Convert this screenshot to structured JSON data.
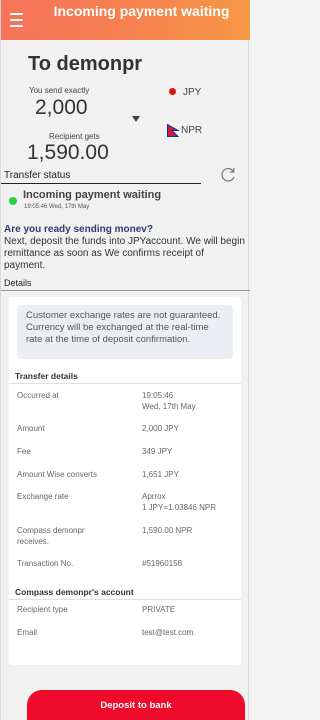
{
  "header": {
    "title": "Incoming payment waiting",
    "accent_color": "#f7804f"
  },
  "summary": {
    "recipient_name": "To demonpr",
    "send_label": "You send exactly",
    "send_amount": "2,000",
    "send_currency": "JPY",
    "receive_label": "Recipient gets",
    "receive_amount": "1,590.00",
    "receive_currency": "NPR"
  },
  "status": {
    "heading": "Transfer status",
    "text": "Incoming payment waiting",
    "time": "19:05:46 Wed, 17th May",
    "dot_color": "#2ecc40",
    "refresh_icon": "refresh-icon"
  },
  "instructions": {
    "question": "Are you ready sending monev?",
    "body": "Next, deposit the funds into JPYaccount. We will begin remittance as soon as We confirms receipt of payment."
  },
  "details": {
    "heading": "Details",
    "notice": "Customer exchange rates are not guaranteed. Currency will be exchanged at the real-time rate at the time of deposit confirmation.",
    "transfer_title": "Transfer details",
    "rows": [
      {
        "label": "Occurred at",
        "value_line1": "19:05:46",
        "value_line2": "Wed, 17th May"
      },
      {
        "label": "Amount",
        "value_line1": "2,000 JPY",
        "value_line2": ""
      },
      {
        "label": "Fee",
        "value_line1": "349 JPY",
        "value_line2": ""
      },
      {
        "label": "Amount Wise converts",
        "value_line1": "1,651 JPY",
        "value_line2": ""
      },
      {
        "label": "Exchange rate",
        "value_line1": "Aprrox",
        "value_line2": "1 JPY=1.03846 NPR"
      },
      {
        "label": "Compass demonpr receives.",
        "value_line1": "1,590.00 NPR",
        "value_line2": ""
      },
      {
        "label": "Transaction No.",
        "value_line1": "#51960158",
        "value_line2": ""
      }
    ],
    "account_title": "Compass demonpr's account",
    "account_rows": [
      {
        "label": "Recipient type",
        "value": "PRIVATE"
      },
      {
        "label": "Email",
        "value": "test@test.com"
      }
    ]
  },
  "actions": {
    "deposit_label": "Deposit to bank",
    "deposit_color": "#ee0a2a"
  }
}
